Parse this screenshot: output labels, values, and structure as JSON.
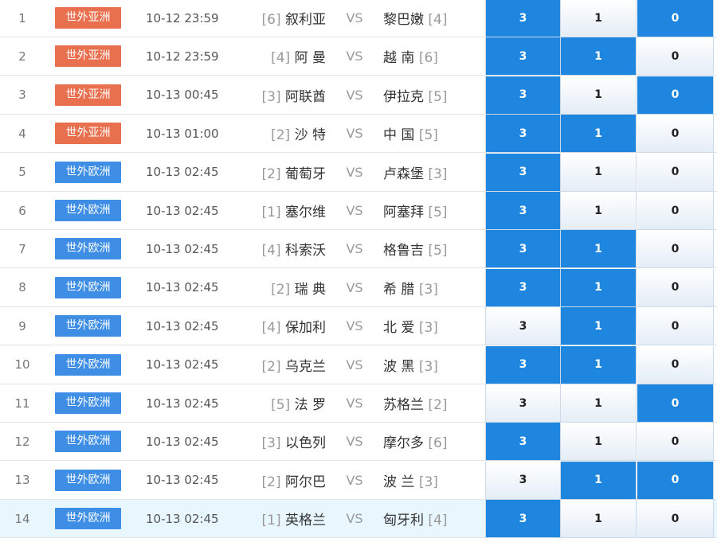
{
  "vs_label": "VS",
  "colors": {
    "asia": "#e8704f",
    "europe": "#3f8ee6",
    "selected": "#1f86e0"
  },
  "options": [
    "3",
    "1",
    "0"
  ],
  "matches": [
    {
      "num": "1",
      "league": "世外亚洲",
      "league_type": "asia",
      "time": "10-12 23:59",
      "home_rank": "[6]",
      "home": "叙利亚",
      "away": "黎巴嫩",
      "away_rank": "[4]",
      "selected": [
        true,
        false,
        true
      ]
    },
    {
      "num": "2",
      "league": "世外亚洲",
      "league_type": "asia",
      "time": "10-12 23:59",
      "home_rank": "[4]",
      "home": "阿 曼",
      "away": "越 南",
      "away_rank": "[6]",
      "selected": [
        true,
        true,
        false
      ]
    },
    {
      "num": "3",
      "league": "世外亚洲",
      "league_type": "asia",
      "time": "10-13 00:45",
      "home_rank": "[3]",
      "home": "阿联酋",
      "away": "伊拉克",
      "away_rank": "[5]",
      "selected": [
        true,
        false,
        true
      ]
    },
    {
      "num": "4",
      "league": "世外亚洲",
      "league_type": "asia",
      "time": "10-13 01:00",
      "home_rank": "[2]",
      "home": "沙 特",
      "away": "中 国",
      "away_rank": "[5]",
      "selected": [
        true,
        true,
        false
      ]
    },
    {
      "num": "5",
      "league": "世外欧洲",
      "league_type": "europe",
      "time": "10-13 02:45",
      "home_rank": "[2]",
      "home": "葡萄牙",
      "away": "卢森堡",
      "away_rank": "[3]",
      "selected": [
        true,
        false,
        false
      ]
    },
    {
      "num": "6",
      "league": "世外欧洲",
      "league_type": "europe",
      "time": "10-13 02:45",
      "home_rank": "[1]",
      "home": "塞尔维",
      "away": "阿塞拜",
      "away_rank": "[5]",
      "selected": [
        true,
        false,
        false
      ]
    },
    {
      "num": "7",
      "league": "世外欧洲",
      "league_type": "europe",
      "time": "10-13 02:45",
      "home_rank": "[4]",
      "home": "科索沃",
      "away": "格鲁吉",
      "away_rank": "[5]",
      "selected": [
        true,
        true,
        false
      ]
    },
    {
      "num": "8",
      "league": "世外欧洲",
      "league_type": "europe",
      "time": "10-13 02:45",
      "home_rank": "[2]",
      "home": "瑞 典",
      "away": "希 腊",
      "away_rank": "[3]",
      "selected": [
        true,
        true,
        false
      ]
    },
    {
      "num": "9",
      "league": "世外欧洲",
      "league_type": "europe",
      "time": "10-13 02:45",
      "home_rank": "[4]",
      "home": "保加利",
      "away": "北 爱",
      "away_rank": "[3]",
      "selected": [
        false,
        true,
        false
      ]
    },
    {
      "num": "10",
      "league": "世外欧洲",
      "league_type": "europe",
      "time": "10-13 02:45",
      "home_rank": "[2]",
      "home": "乌克兰",
      "away": "波 黑",
      "away_rank": "[3]",
      "selected": [
        true,
        true,
        false
      ]
    },
    {
      "num": "11",
      "league": "世外欧洲",
      "league_type": "europe",
      "time": "10-13 02:45",
      "home_rank": "[5]",
      "home": "法 罗",
      "away": "苏格兰",
      "away_rank": "[2]",
      "selected": [
        false,
        false,
        true
      ]
    },
    {
      "num": "12",
      "league": "世外欧洲",
      "league_type": "europe",
      "time": "10-13 02:45",
      "home_rank": "[3]",
      "home": "以色列",
      "away": "摩尔多",
      "away_rank": "[6]",
      "selected": [
        true,
        false,
        false
      ]
    },
    {
      "num": "13",
      "league": "世外欧洲",
      "league_type": "europe",
      "time": "10-13 02:45",
      "home_rank": "[2]",
      "home": "阿尔巴",
      "away": "波 兰",
      "away_rank": "[3]",
      "selected": [
        false,
        true,
        true
      ]
    },
    {
      "num": "14",
      "league": "世外欧洲",
      "league_type": "europe",
      "time": "10-13 02:45",
      "home_rank": "[1]",
      "home": "英格兰",
      "away": "匈牙利",
      "away_rank": "[4]",
      "selected": [
        true,
        false,
        false
      ],
      "highlighted": true
    }
  ]
}
